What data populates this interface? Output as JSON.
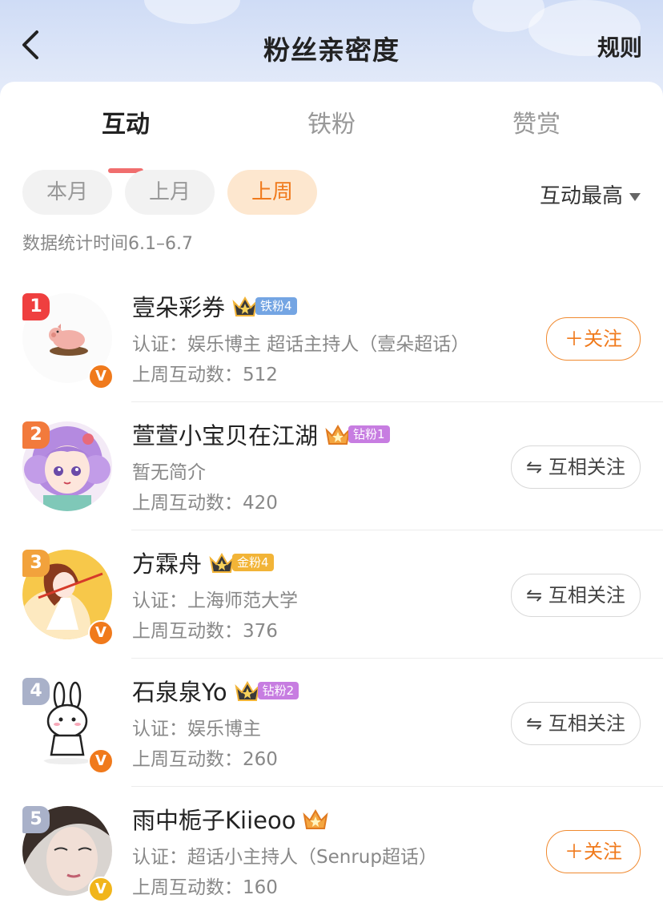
{
  "header": {
    "title": "粉丝亲密度",
    "back_icon": "chevron-left-icon",
    "rules_label": "规则"
  },
  "tabs": [
    {
      "label": "互动",
      "active": true
    },
    {
      "label": "铁粉",
      "active": false
    },
    {
      "label": "赞赏",
      "active": false
    }
  ],
  "filters": {
    "pills": [
      {
        "label": "本月",
        "active": false
      },
      {
        "label": "上月",
        "active": false
      },
      {
        "label": "上周",
        "active": true
      }
    ],
    "sort_label": "互动最高"
  },
  "stat_time": "数据统计时间6.1–6.7",
  "colors": {
    "accent": "#f07a1c",
    "tab_underline": "#f06e6e",
    "rank1": "#ef3f3f",
    "rank2": "#f27a3c",
    "rank3": "#f2a23c",
    "rank_other": "#a9b1c9",
    "verified_orange": "#f07a1c",
    "verified_gold": "#f1b51b"
  },
  "fans": [
    {
      "rank": "1",
      "name": "壹朵彩券",
      "fan_badge": "铁粉4",
      "badge_color": "#74a5e3",
      "desc": "认证：娱乐博主 超话主持人（壹朵超话）",
      "count": "上周互动数：512",
      "button": "＋关注",
      "button_type": "follow",
      "verified": "V"
    },
    {
      "rank": "2",
      "name": "萱萱小宝贝在江湖",
      "fan_badge": "钻粉1",
      "badge_color": "#c77de1",
      "desc": "暂无简介",
      "count": "上周互动数：420",
      "button": "⇋ 互相关注",
      "button_type": "mutual",
      "verified": ""
    },
    {
      "rank": "3",
      "name": "方霖舟",
      "fan_badge": "金粉4",
      "badge_color": "#f2b437",
      "desc": "认证：上海师范大学",
      "count": "上周互动数：376",
      "button": "⇋ 互相关注",
      "button_type": "mutual",
      "verified": "V"
    },
    {
      "rank": "4",
      "name": "石泉泉Yo",
      "fan_badge": "钻粉2",
      "badge_color": "#c77de1",
      "desc": "认证：娱乐博主",
      "count": "上周互动数：260",
      "button": "⇋ 互相关注",
      "button_type": "mutual",
      "verified": "V"
    },
    {
      "rank": "5",
      "name": "雨中栀子Kiieoo",
      "fan_badge": "",
      "badge_color": "#f2b437",
      "desc": "认证：超话小主持人（Senrup超话）",
      "count": "上周互动数：160",
      "button": "＋关注",
      "button_type": "follow",
      "verified": "V"
    }
  ]
}
